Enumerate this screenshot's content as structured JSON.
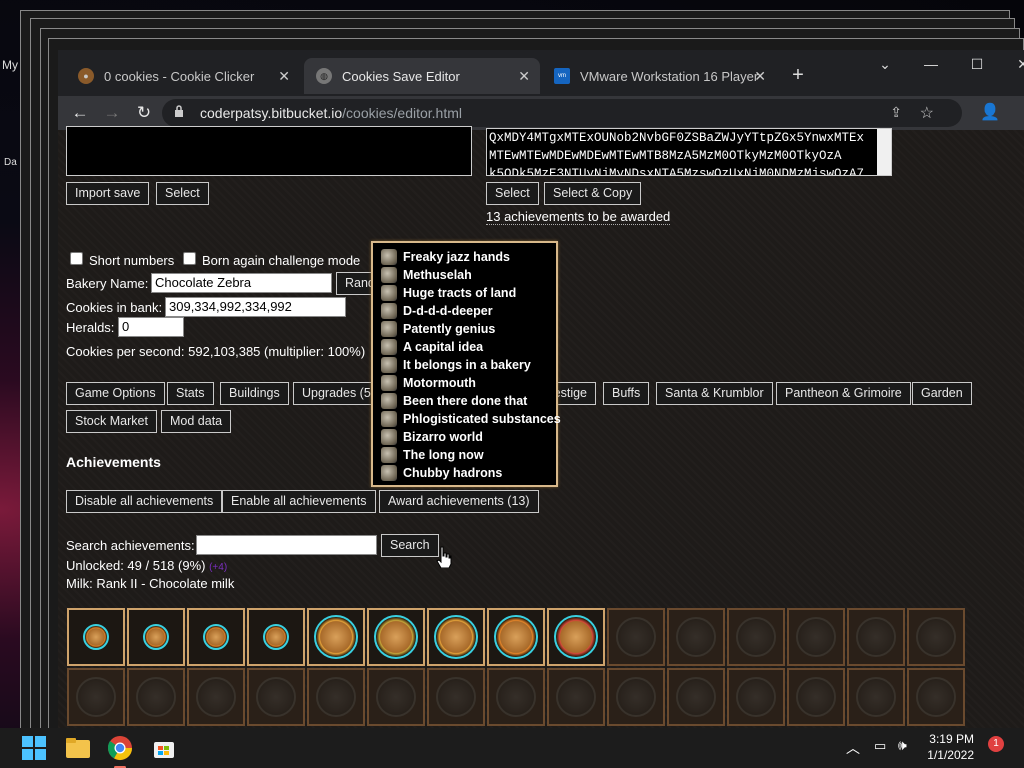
{
  "desktop": {
    "left_label_1": "My",
    "left_label_2": "Da"
  },
  "tabs": [
    {
      "title": "0 cookies - Cookie Clicker",
      "active": false
    },
    {
      "title": "Cookies Save Editor",
      "active": true
    },
    {
      "title": "VMware Workstation 16 Player",
      "active": false
    }
  ],
  "window_controls": {
    "new_tab": "+",
    "dropdown": "⌄",
    "minimize": "—",
    "maximize": "☐",
    "close": "✕"
  },
  "address_bar": {
    "domain": "coderpatsy.bitbucket.io",
    "path": "/cookies/editor.html"
  },
  "save_area": {
    "lines": [
      "QxMDY4MTgxMTExOUNob2NvbGF0ZSBaZWJyYTtpZGx5YnwxMTEx",
      "MTEwMTEwMDEwMDEwMTEwMTB8MzA5MzM0OTkyMzM0OTkyOzA",
      "k5ODk5MzE3NTUyNjMyNDsxNTA5MzswOzUxNjM0NDMzMjswOzA7"
    ],
    "select_label": "Select",
    "select_copy_label": "Select & Copy",
    "awarded_text": "13 achievements to be awarded"
  },
  "import": {
    "import_label": "Import save",
    "select_label": "Select"
  },
  "options": {
    "short_numbers": "Short numbers",
    "born_again": "Born again challenge mode"
  },
  "bakery": {
    "name_label": "Bakery Name:",
    "name_value": "Chocolate Zebra",
    "random_label": "Rand",
    "cookies_label": "Cookies in bank:",
    "cookies_value": "309,334,992,334,992",
    "heralds_label": "Heralds:",
    "heralds_value": "0",
    "cps_text": "Cookies per second: 592,103,385 (multiplier: 100%)"
  },
  "nav_buttons": [
    "Game Options",
    "Stats",
    "Buildings",
    "Upgrades (56",
    "estige",
    "Buffs",
    "Santa & Krumblor",
    "Pantheon & Grimoire",
    "Garden",
    "Stock Market",
    "Mod data"
  ],
  "achievements": {
    "heading": "Achievements",
    "disable_label": "Disable all achievements",
    "enable_label": "Enable all achievements",
    "award_label": "Award achievements (13)",
    "search_label": "Search achievements:",
    "search_value": "",
    "search_button": "Search",
    "unlocked_text": "Unlocked: 49 / 518 (9%)",
    "unlocked_extra": "(+4)",
    "milk_text": "Milk: Rank II - Chocolate milk"
  },
  "popup_items": [
    "Freaky jazz hands",
    "Methuselah",
    "Huge tracts of land",
    "D-d-d-d-deeper",
    "Patently genius",
    "A capital idea",
    "It belongs in a bakery",
    "Motormouth",
    "Been there done that",
    "Phlogisticated substances",
    "Bizarro world",
    "The long now",
    "Chubby hadrons"
  ],
  "taskbar": {
    "time": "3:19 PM",
    "date": "1/1/2022",
    "notification_count": "1"
  },
  "colors": {
    "accent_gold": "#d8b88a",
    "tab_active": "#35363a",
    "page_bg": "#1e1b19"
  }
}
